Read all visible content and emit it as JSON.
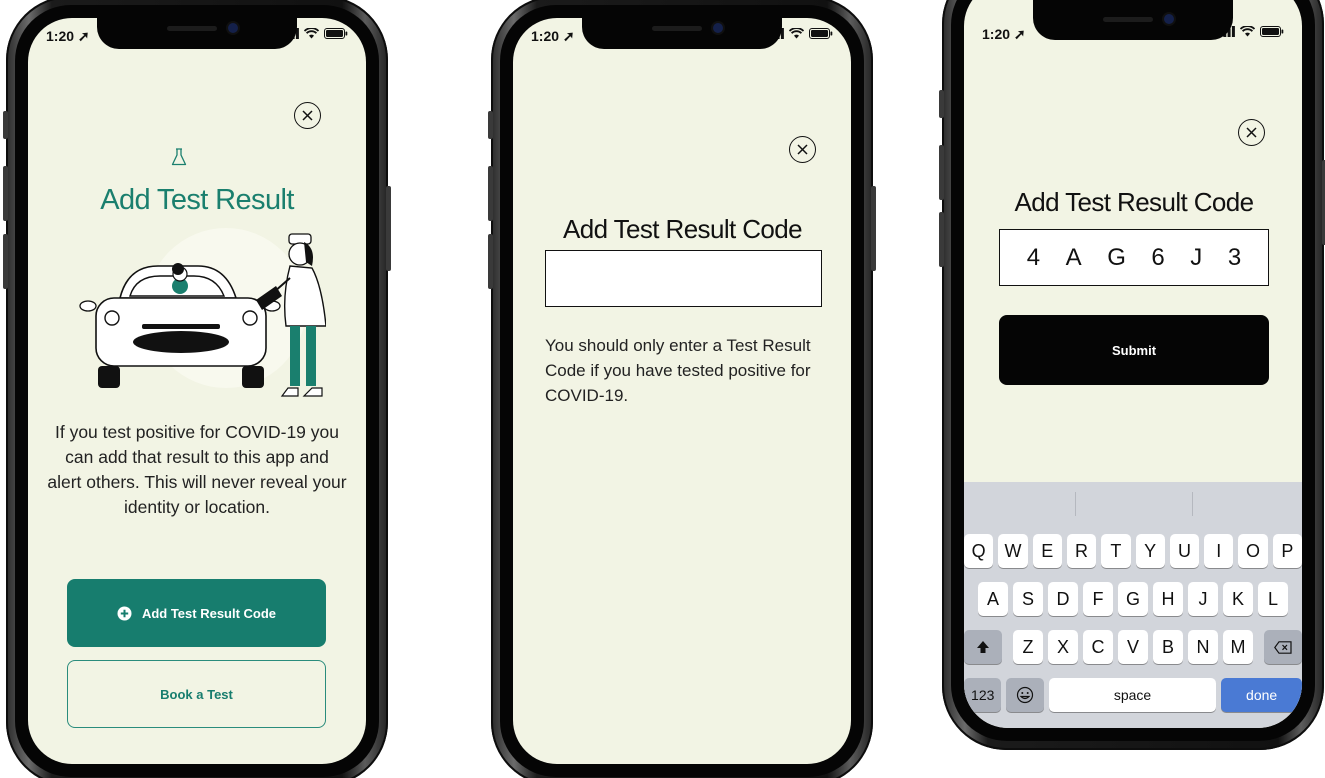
{
  "status_bar": {
    "time": "1:20"
  },
  "screen1": {
    "title": "Add Test Result",
    "description": "If you test positive for COVID-19 you can add that result to this app and alert others. This will never reveal your identity or location.",
    "primary_button": "Add Test Result Code",
    "secondary_button": "Book a Test"
  },
  "screen2": {
    "title": "Add Test Result Code",
    "code_value": "",
    "note": "You should only enter a Test Result Code if you have tested positive for COVID-19."
  },
  "screen3": {
    "title": "Add Test Result Code",
    "code_chars": [
      "4",
      "A",
      "G",
      "6",
      "J",
      "3"
    ],
    "submit_button": "Submit"
  },
  "keyboard": {
    "row1": [
      "Q",
      "W",
      "E",
      "R",
      "T",
      "Y",
      "U",
      "I",
      "O",
      "P"
    ],
    "row2": [
      "A",
      "S",
      "D",
      "F",
      "G",
      "H",
      "J",
      "K",
      "L"
    ],
    "row3": [
      "Z",
      "X",
      "C",
      "V",
      "B",
      "N",
      "M"
    ],
    "numbers_key": "123",
    "space_key": "space",
    "done_key": "done"
  },
  "colors": {
    "accent": "#177d6e",
    "screen_bg": "#f2f4e4",
    "keyboard_bg": "#d2d5db",
    "done_blue": "#4a7ad4"
  }
}
